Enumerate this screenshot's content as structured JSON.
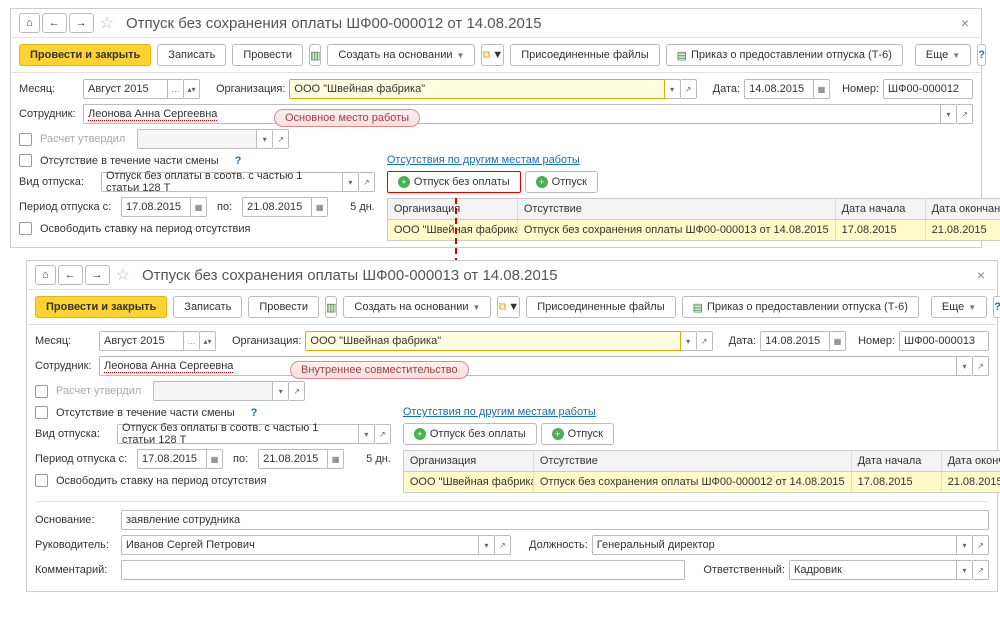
{
  "win1": {
    "title": "Отпуск без сохранения оплаты ШФ00-000012 от 14.08.2015",
    "toolbar": {
      "submit": "Провести и закрыть",
      "save": "Записать",
      "post": "Провести",
      "create_on_basis": "Создать на основании",
      "attached": "Присоединенные файлы",
      "order": "Приказ о предоставлении отпуска (Т-6)",
      "more": "Еще"
    },
    "month_label": "Месяц:",
    "month": "Август 2015",
    "org_label": "Организация:",
    "org": "ООО \"Швейная фабрика\"",
    "date_label": "Дата:",
    "date": "14.08.2015",
    "num_label": "Номер:",
    "num": "ШФ00-000012",
    "emp_label": "Сотрудник:",
    "emp": "Леонова Анна Сергеевна",
    "badge": "Основное место работы",
    "approved": "Расчет утвердил",
    "shift": "Отсутствие в течение части смены",
    "absences_link": "Отсутствия по другим местам работы",
    "type_label": "Вид отпуска:",
    "type": "Отпуск без оплаты в соотв. с частью 1 статьи 128 Т",
    "btn_unpaid": "Отпуск без оплаты",
    "btn_leave": "Отпуск",
    "period_label": "Период отпуска с:",
    "from": "17.08.2015",
    "to_label": "по:",
    "to": "21.08.2015",
    "days": "5 дн.",
    "release": "Освободить ставку на период отсутствия",
    "table": {
      "h1": "Организация",
      "h2": "Отсутствие",
      "h3": "Дата начала",
      "h4": "Дата окончания",
      "r": {
        "org": "ООО \"Швейная фабрика\"",
        "abs": "Отпуск без сохранения оплаты ШФ00-000013 от 14.08.2015",
        "d1": "17.08.2015",
        "d2": "21.08.2015"
      }
    }
  },
  "win2": {
    "title": "Отпуск без сохранения оплаты ШФ00-000013 от 14.08.2015",
    "toolbar": {
      "submit": "Провести и закрыть",
      "save": "Записать",
      "post": "Провести",
      "create_on_basis": "Создать на основании",
      "attached": "Присоединенные файлы",
      "order": "Приказ о предоставлении отпуска (Т-6)",
      "more": "Еще"
    },
    "month_label": "Месяц:",
    "month": "Август 2015",
    "org_label": "Организация:",
    "org": "ООО \"Швейная фабрика\"",
    "date_label": "Дата:",
    "date": "14.08.2015",
    "num_label": "Номер:",
    "num": "ШФ00-000013",
    "emp_label": "Сотрудник:",
    "emp": "Леонова Анна Сергеевна",
    "badge": "Внутреннее совместительство",
    "approved": "Расчет утвердил",
    "shift": "Отсутствие в течение части смены",
    "absences_link": "Отсутствия по другим местам работы",
    "type_label": "Вид отпуска:",
    "type": "Отпуск без оплаты в соотв. с частью 1 статьи 128 Т",
    "btn_unpaid": "Отпуск без оплаты",
    "btn_leave": "Отпуск",
    "period_label": "Период отпуска с:",
    "from": "17.08.2015",
    "to_label": "по:",
    "to": "21.08.2015",
    "days": "5 дн.",
    "release": "Освободить ставку на период отсутствия",
    "table": {
      "h1": "Организация",
      "h2": "Отсутствие",
      "h3": "Дата начала",
      "h4": "Дата окончания",
      "r": {
        "org": "ООО \"Швейная фабрика\"",
        "abs": "Отпуск без сохранения оплаты ШФ00-000012 от 14.08.2015",
        "d1": "17.08.2015",
        "d2": "21.08.2015"
      }
    },
    "basis_label": "Основание:",
    "basis": "заявление сотрудника",
    "head_label": "Руководитель:",
    "head": "Иванов Сергей Петрович",
    "position_label": "Должность:",
    "position": "Генеральный директор",
    "comment_label": "Комментарий:",
    "resp_label": "Ответственный:",
    "resp": "Кадровик"
  }
}
